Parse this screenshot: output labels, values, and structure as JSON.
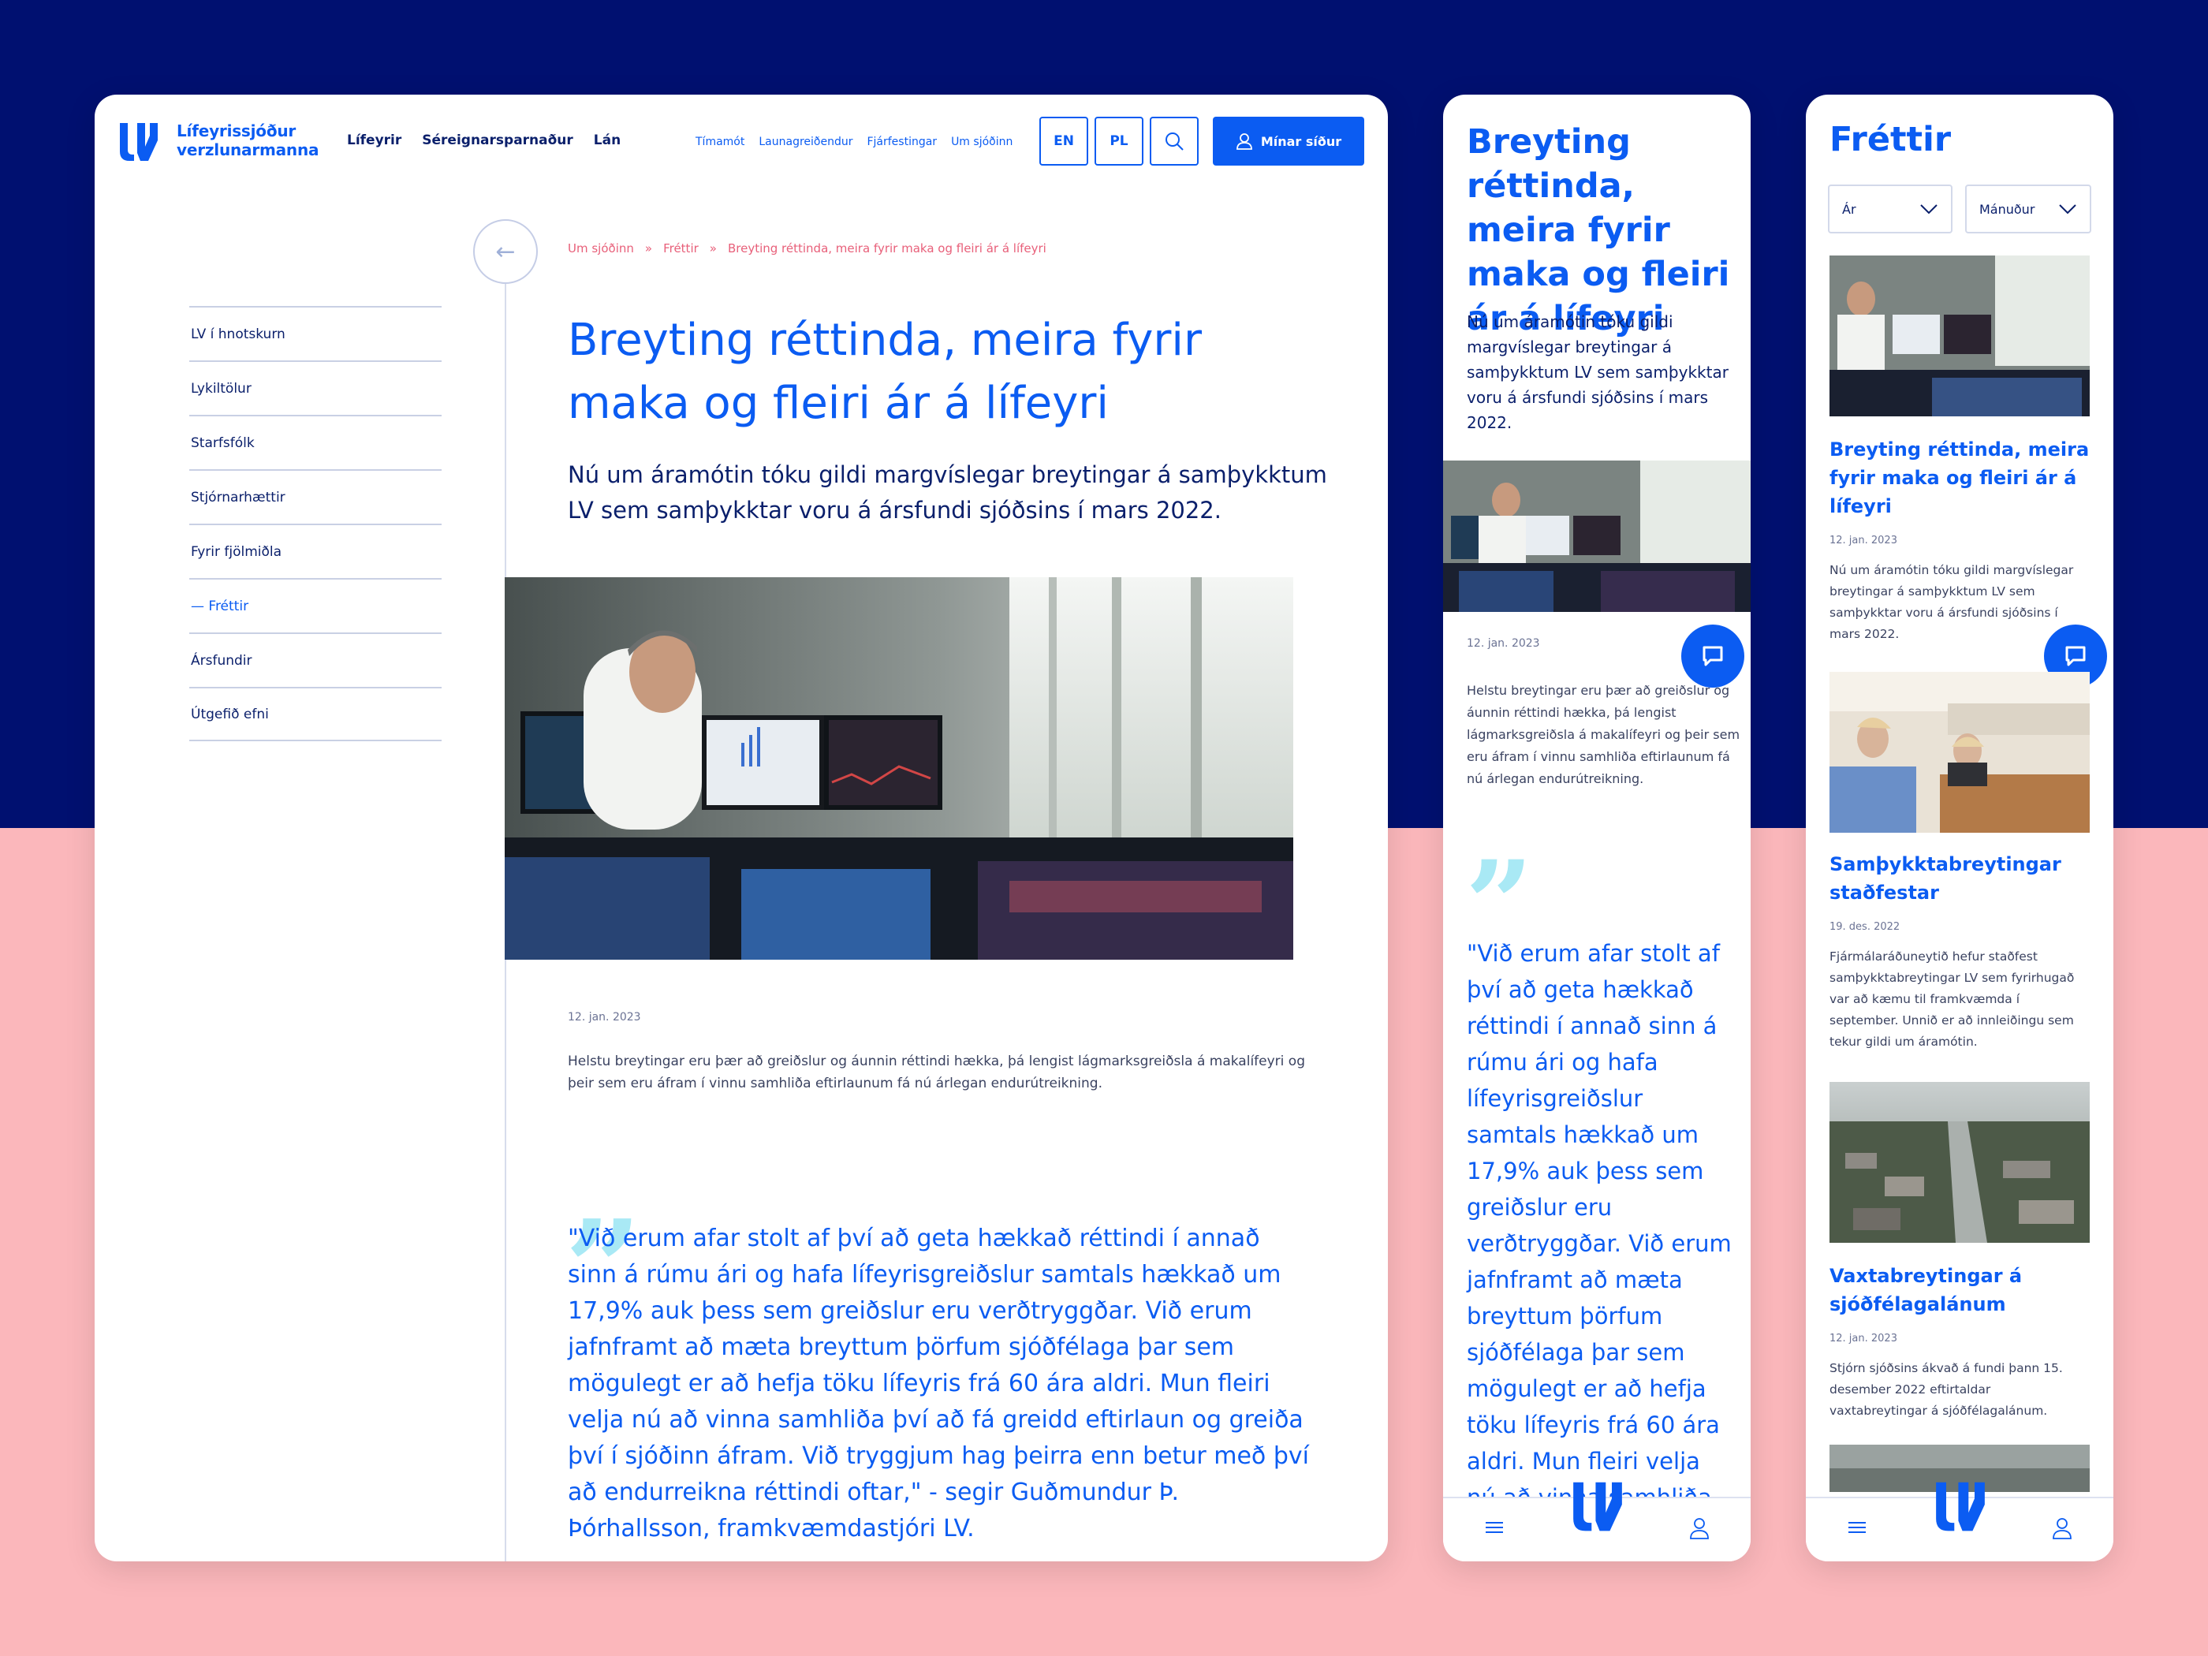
{
  "brand": {
    "name_line1": "Lífeyrissjóður",
    "name_line2": "verzlunarmanna"
  },
  "header": {
    "main_nav": [
      "Lífeyrir",
      "Séreignarsparnaður",
      "Lán"
    ],
    "sub_nav": [
      "Tímamót",
      "Launagreiðendur",
      "Fjárfestingar",
      "Um sjóðinn"
    ],
    "lang_en": "EN",
    "lang_pl": "PL",
    "login_label": "Mínar síður"
  },
  "sidebar": {
    "items": [
      "LV í hnotskurn",
      "Lykiltölur",
      "Starfsfólk",
      "Stjórnarhættir",
      "Fyrir fjölmiðla",
      "— Fréttir",
      "Ársfundir",
      "Útgefið efni"
    ]
  },
  "breadcrumb": [
    "Um sjóðinn",
    "»",
    "Fréttir",
    "»",
    "Breyting réttinda, meira fyrir maka og fleiri ár á lífeyri"
  ],
  "article": {
    "title": "Breyting réttinda, meira fyrir maka og fleiri ár á lífeyri",
    "lead": "Nú um áramótin tóku gildi margvíslegar breytingar á samþykktum LV sem samþykktar voru á ársfundi sjóðsins í mars 2022.",
    "date": "12. jan. 2023",
    "body": "Helstu breytingar eru þær að greiðslur og áunnin réttindi hækka, þá lengist lágmarksgreiðsla á makalífeyri og þeir sem eru áfram í vinnu samhliða eftirlaunum fá nú árlegan endurútreikning.",
    "quote_mark": "”",
    "quote": "\"Við erum afar stolt af því að geta hækkað réttindi í annað sinn á rúmu ári og hafa lífeyrisgreiðslur samtals hækkað um 17,9% auk þess sem greiðslur eru verðtryggðar. Við erum jafnframt að mæta breyttum þörfum sjóðfélaga þar sem mögulegt er að hefja töku lífeyris frá 60 ára aldri. Mun fleiri velja nú að vinna samhliða því að fá greidd eftirlaun og greiða því í sjóðinn áfram. Við tryggjum hag þeirra enn betur með því að endurreikna réttindi oftar,\" - segir Guðmundur Þ. Þórhallsson, framkvæmdastjóri LV."
  },
  "mobile_article": {
    "title": "Breyting réttinda, meira fyrir maka og fleiri ár á lífeyri",
    "lead": "Nú um áramótin tóku gildi margvíslegar breytingar á samþykktum LV sem samþykktar voru á ársfundi sjóðsins í mars 2022.",
    "date": "12. jan. 2023",
    "body": "Helstu breytingar eru þær að greiðslur og áunnin réttindi hækka, þá lengist lágmarksgreiðsla á makalífeyri og þeir sem eru áfram í vinnu samhliða eftirlaunum fá nú árlegan endurútreikning.",
    "quote_mark": "”",
    "quote": "\"Við erum afar stolt af því að geta hækkað réttindi í annað sinn á rúmu ári og hafa lífeyrisgreiðslur samtals hækkað um 17,9% auk þess sem greiðslur eru verðtryggðar. Við erum jafnframt að mæta breyttum þörfum sjóðfélaga þar sem mögulegt er að hefja töku lífeyris frá 60 ára aldri. Mun fleiri velja nú að vinna samhliða því að fá greidd"
  },
  "news": {
    "title": "Fréttir",
    "filter_year": "Ár",
    "filter_month": "Mánuður",
    "items": [
      {
        "title": "Breyting réttinda, meira fyrir maka og fleiri ár á lífeyri",
        "date": "12. jan. 2023",
        "excerpt": "Nú um áramótin tóku gildi margvíslegar breytingar á samþykktum LV sem samþykktar voru á ársfundi sjóðsins í mars 2022."
      },
      {
        "title": "Samþykktabreytingar staðfestar",
        "date": "19. des. 2022",
        "excerpt": "Fjármálaráðuneytið hefur staðfest samþykktabreytingar LV sem fyrirhugað var að kæmu til framkvæmda í september. Unnið er að innleiðingu sem tekur gildi um áramótin."
      },
      {
        "title": "Vaxtabreytingar á sjóðfélagalánum",
        "date": "12. jan. 2023",
        "excerpt": "Stjórn sjóðsins ákvað á fundi þann 15. desember 2022 eftirtaldar vaxtabreytingar á sjóðfélagalánum."
      }
    ]
  },
  "colors": {
    "primary": "#0b5cf2",
    "navy": "#0a1f6b",
    "top_bg": "#001070",
    "bottom_bg": "#fbb7bb",
    "accent_pink": "#e8607a",
    "quote_cyan": "#a9e9f5"
  }
}
